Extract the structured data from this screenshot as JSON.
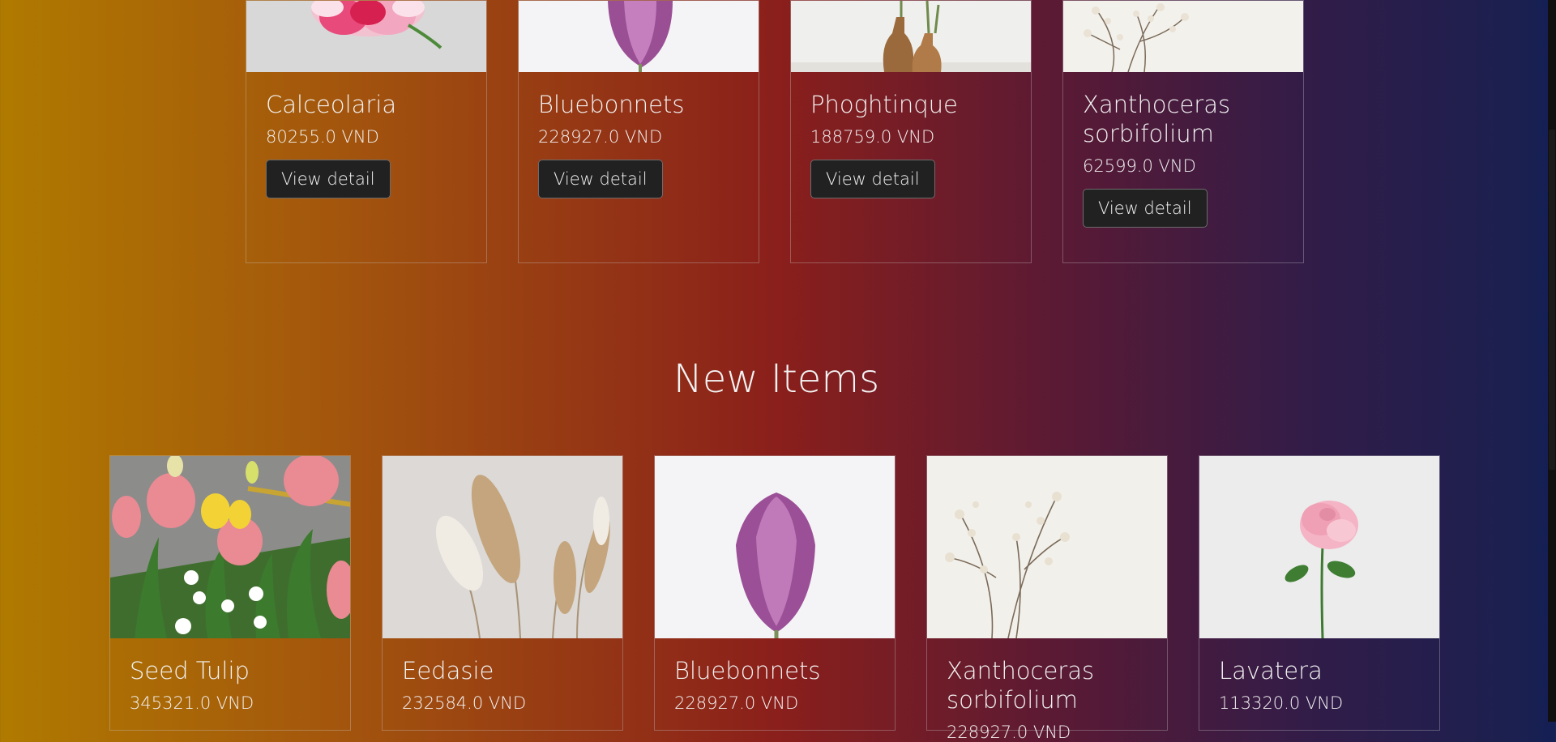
{
  "top_row": [
    {
      "name": "Calceolaria",
      "price": "80255.0 VND",
      "button": "View detail"
    },
    {
      "name": "Bluebonnets",
      "price": "228927.0 VND",
      "button": "View detail"
    },
    {
      "name": "Phoghtinque",
      "price": "188759.0 VND",
      "button": "View detail"
    },
    {
      "name": "Xanthoceras sorbifolium",
      "price": "62599.0 VND",
      "button": "View detail"
    }
  ],
  "new_items": {
    "title": "New Items",
    "items": [
      {
        "name": "Seed Tulip",
        "price": "345321.0 VND"
      },
      {
        "name": "Eedasie",
        "price": "232584.0 VND"
      },
      {
        "name": "Bluebonnets",
        "price": "228927.0 VND"
      },
      {
        "name": "Xanthoceras sorbifolium",
        "price": "228927.0 VND"
      },
      {
        "name": "Lavatera",
        "price": "113320.0 VND"
      }
    ]
  }
}
